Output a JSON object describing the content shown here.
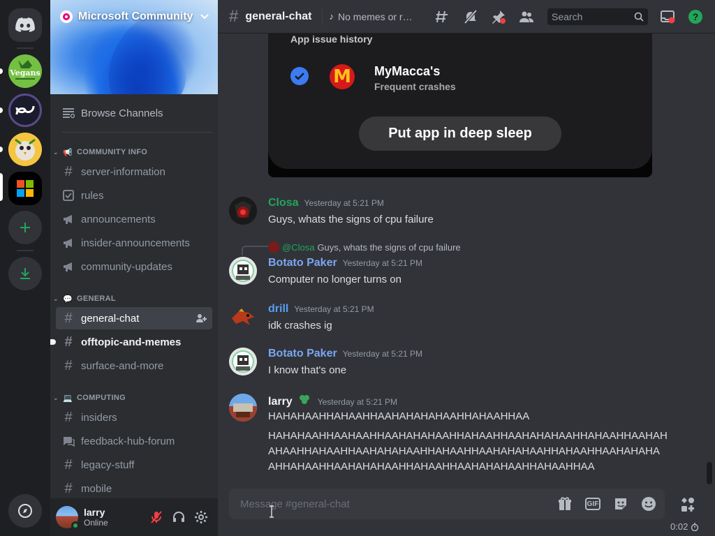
{
  "servers": {
    "home": "discord-home",
    "vegans_label": "Vegans",
    "items": [
      "vegans",
      "ae-server",
      "bird-server",
      "microsoft-community"
    ]
  },
  "server": {
    "name": "Microsoft Community"
  },
  "sidebar": {
    "browse_label": "Browse Channels",
    "categories": [
      {
        "name": "COMMUNITY INFO",
        "channels": [
          {
            "name": "server-information",
            "icon": "hash"
          },
          {
            "name": "rules",
            "icon": "rules-check"
          },
          {
            "name": "announcements",
            "icon": "megaphone"
          },
          {
            "name": "insider-announcements",
            "icon": "megaphone"
          },
          {
            "name": "community-updates",
            "icon": "megaphone"
          }
        ]
      },
      {
        "name": "GENERAL",
        "channels": [
          {
            "name": "general-chat",
            "icon": "hash",
            "active": true
          },
          {
            "name": "offtopic-and-memes",
            "icon": "hash",
            "unread": true
          },
          {
            "name": "surface-and-more",
            "icon": "hash"
          }
        ]
      },
      {
        "name": "COMPUTING",
        "channels": [
          {
            "name": "insiders",
            "icon": "hash"
          },
          {
            "name": "feedback-hub-forum",
            "icon": "forum"
          },
          {
            "name": "legacy-stuff",
            "icon": "hash"
          },
          {
            "name": "mobile",
            "icon": "hash"
          }
        ]
      }
    ]
  },
  "user": {
    "name": "larry",
    "status": "Online"
  },
  "topbar": {
    "channel": "general-chat",
    "topic": "No memes or ra...",
    "search_placeholder": "Search"
  },
  "embed": {
    "title": "App issue history",
    "app_name": "MyMacca's",
    "app_issue": "Frequent crashes",
    "logo_letter": "M",
    "button": "Put app in deep sleep"
  },
  "messages": [
    {
      "author": "Closa",
      "time": "Yesterday at 5:21 PM",
      "text": "Guys, whats the signs of cpu failure",
      "color": "#23a55a"
    },
    {
      "author": "Botato Paker",
      "time": "Yesterday at 5:21 PM",
      "text": "Computer no longer turns on",
      "color": "#7ba6f2",
      "reply": {
        "author": "@Closa",
        "text": "Guys, whats the signs of cpu failure"
      }
    },
    {
      "author": "drill",
      "time": "Yesterday at 5:21 PM",
      "text": "idk crashes ig",
      "color": "#5a9cf5"
    },
    {
      "author": "Botato Paker",
      "time": "Yesterday at 5:21 PM",
      "text": "I know that's one",
      "color": "#7ba6f2"
    },
    {
      "author": "larry",
      "time": "Yesterday at 5:21 PM",
      "color": "#f2f3f5",
      "lines": [
        "HAHAHAAHHAHAAHHAAHAHAHAHAAHHAHAAHHAA",
        "HAHAHAAHHAAHAAHHAAHAHAHAAHHAHAAHHAAHAHAHAAHHAHAAHHAAHAH",
        "AHAAHHAHAAHHAAHAHAHAAHHAHAAHHAAHAHAHAAHHAHAAHHAAHAHAHA",
        "AHHAHAAHHAAHAHAHAAHHAHAAHHAAHAHAHAAHHAHAAHHAA"
      ]
    }
  ],
  "composer": {
    "placeholder": "Message #general-chat",
    "gif_label": "GIF"
  },
  "timer": "0:02",
  "colors": {
    "accent_green": "#23a55a",
    "background": "#313338",
    "sidebar": "#2b2d31",
    "rail": "#1e1f22"
  }
}
